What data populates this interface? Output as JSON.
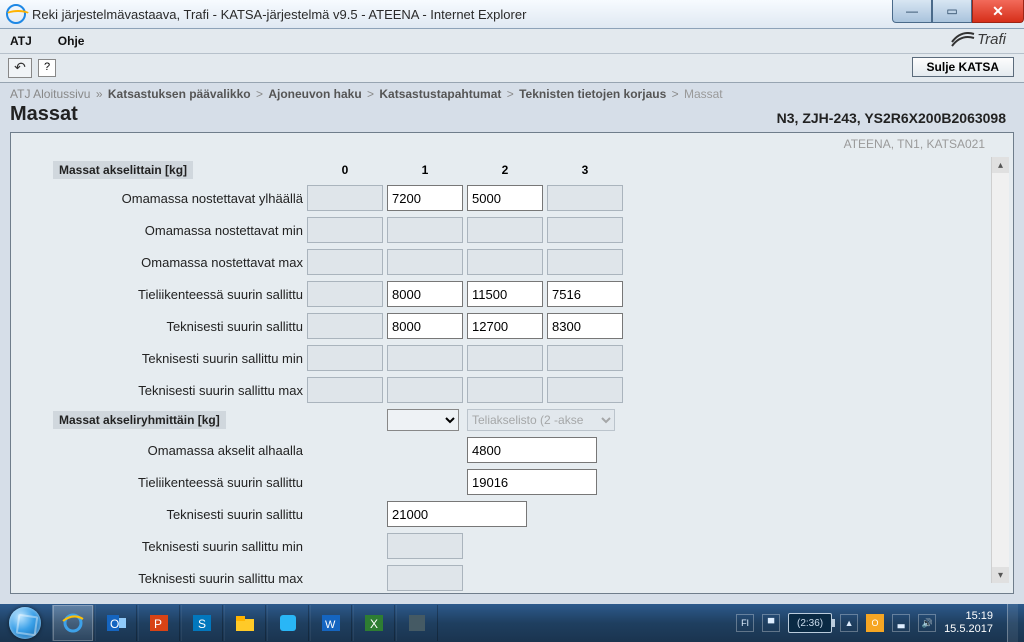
{
  "titlebar": {
    "title": "Reki järjestelmävastaava, Trafi - KATSA-järjestelmä v9.5 - ATEENA - Internet Explorer"
  },
  "menubar": {
    "atj": "ATJ",
    "ohje": "Ohje",
    "brand": "Trafi"
  },
  "toolbar": {
    "close_btn": "Sulje KATSA"
  },
  "crumbs": {
    "root": "ATJ Aloitussivu",
    "c1": "Katsastuksen päävalikko",
    "c2": "Ajoneuvon haku",
    "c3": "Katsastustapahtumat",
    "c4": "Teknisten tietojen korjaus",
    "cur": "Massat",
    "sep": ">",
    "rootsep": "»"
  },
  "header": {
    "title": "Massat",
    "vehicle": "N3, ZJH-243, YS2R6X200B2063098"
  },
  "meta": "ATEENA, TN1, KATSA021",
  "grid": {
    "section1": "Massat akselittain [kg]",
    "cols": {
      "c0": "0",
      "c1": "1",
      "c2": "2",
      "c3": "3"
    },
    "rows": {
      "r1": {
        "label": "Omamassa nostettavat ylhäällä",
        "v0": "",
        "v1": "7200",
        "v2": "5000",
        "v3": ""
      },
      "r2": {
        "label": "Omamassa nostettavat min"
      },
      "r3": {
        "label": "Omamassa nostettavat max"
      },
      "r4": {
        "label": "Tieliikenteessä suurin sallittu",
        "v1": "8000",
        "v2": "11500",
        "v3": "7516"
      },
      "r5": {
        "label": "Teknisesti suurin sallittu",
        "v1": "8000",
        "v2": "12700",
        "v3": "8300"
      },
      "r6": {
        "label": "Teknisesti suurin sallittu min"
      },
      "r7": {
        "label": "Teknisesti suurin sallittu max"
      }
    },
    "section2": "Massat akseliryhmittäin [kg]",
    "groupsel": "Teliakselisto (2 -akse",
    "grows": {
      "g1": {
        "label": "Omamassa akselit alhaalla",
        "v": "4800"
      },
      "g2": {
        "label": "Tieliikenteessä suurin sallittu",
        "v": "19016"
      },
      "g3": {
        "label": "Teknisesti suurin sallittu",
        "v": "21000"
      },
      "g4": {
        "label": "Teknisesti suurin sallittu min"
      },
      "g5": {
        "label": "Teknisesti suurin sallittu max"
      }
    }
  },
  "tray": {
    "lang": "FI",
    "battery": "(2:36)",
    "time": "15:19",
    "date": "15.5.2017"
  }
}
